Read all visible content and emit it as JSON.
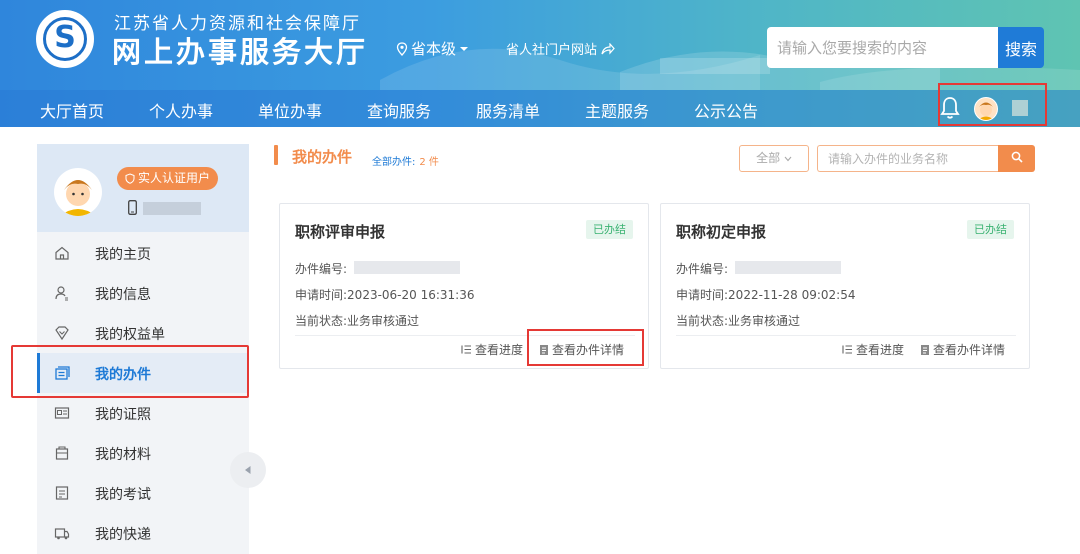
{
  "header": {
    "org_name": "江苏省人力资源和社会保障厅",
    "site_name": "网上办事服务大厅",
    "region": "省本级",
    "portal_link": "省人社门户网站",
    "search_placeholder": "请输入您要搜索的内容",
    "search_button": "搜索"
  },
  "nav": {
    "items": [
      "大厅首页",
      "个人办事",
      "单位办事",
      "查询服务",
      "服务清单",
      "主题服务",
      "公示公告"
    ]
  },
  "sidebar": {
    "verified_badge": "实人认证用户",
    "items": [
      {
        "label": "我的主页",
        "icon": "home-icon"
      },
      {
        "label": "我的信息",
        "icon": "user-info-icon"
      },
      {
        "label": "我的权益单",
        "icon": "rights-icon"
      },
      {
        "label": "我的办件",
        "icon": "cases-icon",
        "active": true
      },
      {
        "label": "我的证照",
        "icon": "license-icon"
      },
      {
        "label": "我的材料",
        "icon": "materials-icon"
      },
      {
        "label": "我的考试",
        "icon": "exam-icon"
      },
      {
        "label": "我的快递",
        "icon": "delivery-icon"
      }
    ]
  },
  "main": {
    "title": "我的办件",
    "total_label": "全部办件:",
    "total_count": "2 件",
    "filter_selected": "全部",
    "biz_search_placeholder": "请输入办件的业务名称",
    "cards": [
      {
        "title": "职称评审申报",
        "badge": "已办结",
        "case_no_label": "办件编号:",
        "apply_time_label": "申请时间:",
        "apply_time": "2023-06-20 16:31:36",
        "status_label": "当前状态:",
        "status": "业务审核通过",
        "progress_label": "查看进度",
        "detail_label": "查看办件详情"
      },
      {
        "title": "职称初定申报",
        "badge": "已办结",
        "case_no_label": "办件编号:",
        "apply_time_label": "申请时间:",
        "apply_time": "2022-11-28 09:02:54",
        "status_label": "当前状态:",
        "status": "业务审核通过",
        "progress_label": "查看进度",
        "detail_label": "查看办件详情"
      }
    ]
  },
  "colors": {
    "primary": "#1e7ad6",
    "accent": "#f28c4c",
    "highlight": "#e53935",
    "done": "#3bb272"
  }
}
